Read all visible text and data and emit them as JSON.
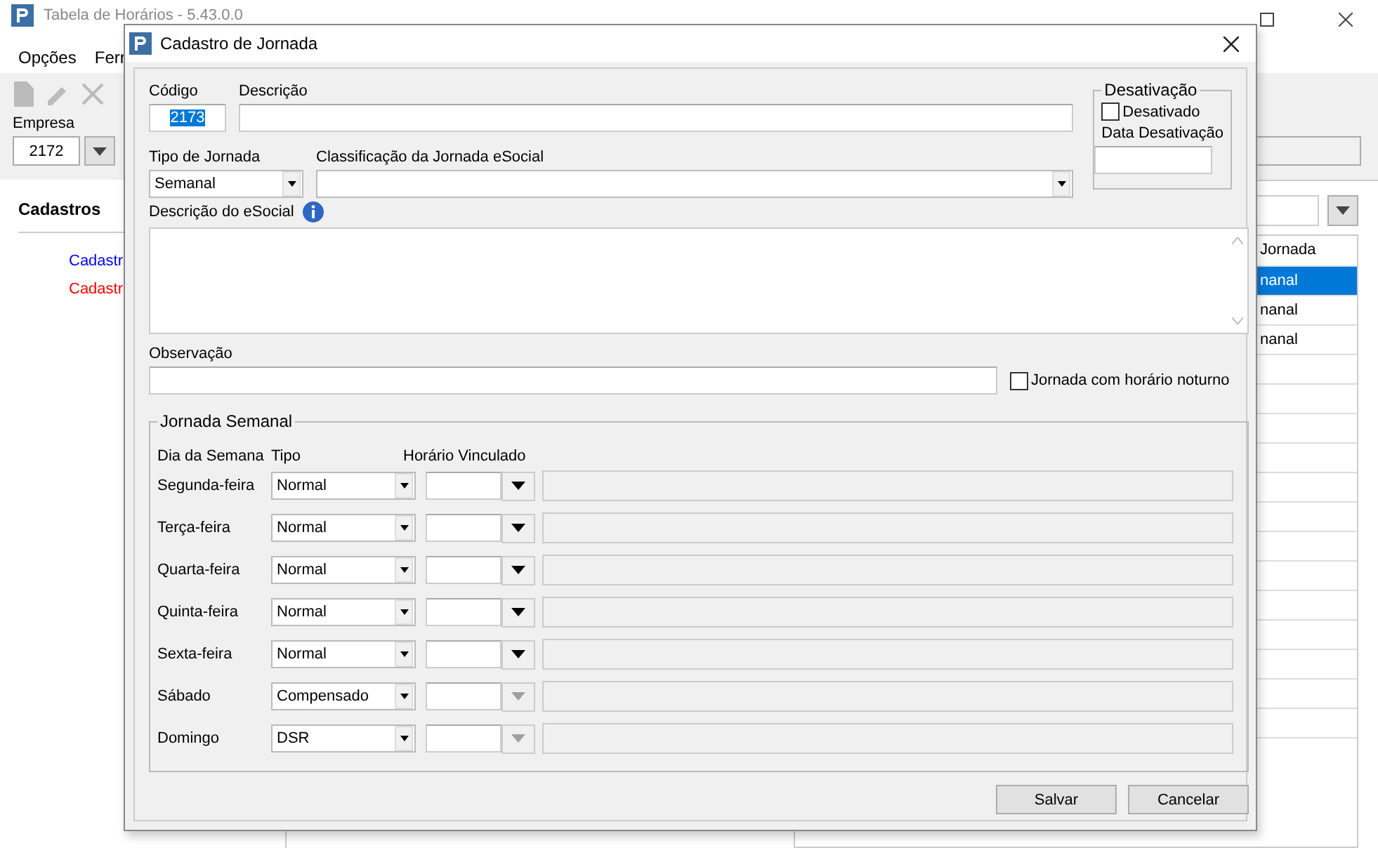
{
  "main_window": {
    "title": "Tabela de Horários - 5.43.0.0",
    "menu": [
      "Opções",
      "Ferr"
    ],
    "empresa": {
      "label": "Empresa",
      "value": "2172"
    },
    "sidebar": {
      "heading": "Cadastros",
      "items": [
        {
          "label": "Cadastr",
          "color": "#0000ff"
        },
        {
          "label": "Cadastr",
          "color": "#ff0000"
        }
      ]
    },
    "grid": {
      "column_1": "Jornada",
      "rows": [
        {
          "text": "nanal",
          "selected": true
        },
        {
          "text": "nanal",
          "selected": false
        },
        {
          "text": "nanal",
          "selected": false
        }
      ]
    }
  },
  "dialog": {
    "title": "Cadastro de Jornada",
    "codigo": {
      "label": "Código",
      "value": "2173"
    },
    "descricao": {
      "label": "Descrição"
    },
    "tipo_jornada": {
      "label": "Tipo de Jornada",
      "value": "Semanal"
    },
    "classificacao": {
      "label": "Classificação da Jornada eSocial"
    },
    "desativacao": {
      "title": "Desativação",
      "checkbox": {
        "label": "Desativado",
        "checked": false
      },
      "data_label": "Data Desativação"
    },
    "descricao_esocial": {
      "label": "Descrição do eSocial"
    },
    "observacao": {
      "label": "Observação"
    },
    "noturno": {
      "label": "Jornada com horário noturno",
      "checked": false
    },
    "jornada_semanal": {
      "title": "Jornada Semanal",
      "headers": [
        "Dia da Semana",
        "Tipo",
        "Horário Vinculado"
      ],
      "days": [
        {
          "day": "Segunda-feira",
          "tipo": "Normal",
          "disabled": false
        },
        {
          "day": "Terça-feira",
          "tipo": "Normal",
          "disabled": false
        },
        {
          "day": "Quarta-feira",
          "tipo": "Normal",
          "disabled": false
        },
        {
          "day": "Quinta-feira",
          "tipo": "Normal",
          "disabled": false
        },
        {
          "day": "Sexta-feira",
          "tipo": "Normal",
          "disabled": false
        },
        {
          "day": "Sábado",
          "tipo": "Compensado",
          "disabled": true
        },
        {
          "day": "Domingo",
          "tipo": "DSR",
          "disabled": true
        }
      ]
    },
    "buttons": [
      "Salvar",
      "Cancelar"
    ]
  }
}
